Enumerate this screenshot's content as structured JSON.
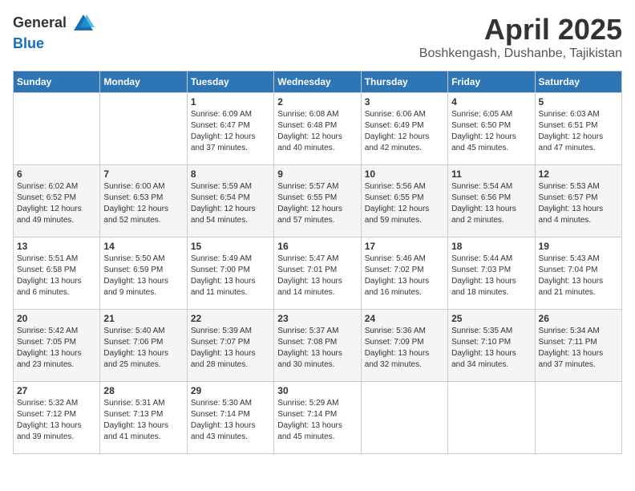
{
  "header": {
    "logo_general": "General",
    "logo_blue": "Blue",
    "month_title": "April 2025",
    "location": "Boshkengash, Dushanbe, Tajikistan"
  },
  "weekdays": [
    "Sunday",
    "Monday",
    "Tuesday",
    "Wednesday",
    "Thursday",
    "Friday",
    "Saturday"
  ],
  "weeks": [
    [
      {
        "day": "",
        "info": ""
      },
      {
        "day": "",
        "info": ""
      },
      {
        "day": "1",
        "info": "Sunrise: 6:09 AM\nSunset: 6:47 PM\nDaylight: 12 hours\nand 37 minutes."
      },
      {
        "day": "2",
        "info": "Sunrise: 6:08 AM\nSunset: 6:48 PM\nDaylight: 12 hours\nand 40 minutes."
      },
      {
        "day": "3",
        "info": "Sunrise: 6:06 AM\nSunset: 6:49 PM\nDaylight: 12 hours\nand 42 minutes."
      },
      {
        "day": "4",
        "info": "Sunrise: 6:05 AM\nSunset: 6:50 PM\nDaylight: 12 hours\nand 45 minutes."
      },
      {
        "day": "5",
        "info": "Sunrise: 6:03 AM\nSunset: 6:51 PM\nDaylight: 12 hours\nand 47 minutes."
      }
    ],
    [
      {
        "day": "6",
        "info": "Sunrise: 6:02 AM\nSunset: 6:52 PM\nDaylight: 12 hours\nand 49 minutes."
      },
      {
        "day": "7",
        "info": "Sunrise: 6:00 AM\nSunset: 6:53 PM\nDaylight: 12 hours\nand 52 minutes."
      },
      {
        "day": "8",
        "info": "Sunrise: 5:59 AM\nSunset: 6:54 PM\nDaylight: 12 hours\nand 54 minutes."
      },
      {
        "day": "9",
        "info": "Sunrise: 5:57 AM\nSunset: 6:55 PM\nDaylight: 12 hours\nand 57 minutes."
      },
      {
        "day": "10",
        "info": "Sunrise: 5:56 AM\nSunset: 6:55 PM\nDaylight: 12 hours\nand 59 minutes."
      },
      {
        "day": "11",
        "info": "Sunrise: 5:54 AM\nSunset: 6:56 PM\nDaylight: 13 hours\nand 2 minutes."
      },
      {
        "day": "12",
        "info": "Sunrise: 5:53 AM\nSunset: 6:57 PM\nDaylight: 13 hours\nand 4 minutes."
      }
    ],
    [
      {
        "day": "13",
        "info": "Sunrise: 5:51 AM\nSunset: 6:58 PM\nDaylight: 13 hours\nand 6 minutes."
      },
      {
        "day": "14",
        "info": "Sunrise: 5:50 AM\nSunset: 6:59 PM\nDaylight: 13 hours\nand 9 minutes."
      },
      {
        "day": "15",
        "info": "Sunrise: 5:49 AM\nSunset: 7:00 PM\nDaylight: 13 hours\nand 11 minutes."
      },
      {
        "day": "16",
        "info": "Sunrise: 5:47 AM\nSunset: 7:01 PM\nDaylight: 13 hours\nand 14 minutes."
      },
      {
        "day": "17",
        "info": "Sunrise: 5:46 AM\nSunset: 7:02 PM\nDaylight: 13 hours\nand 16 minutes."
      },
      {
        "day": "18",
        "info": "Sunrise: 5:44 AM\nSunset: 7:03 PM\nDaylight: 13 hours\nand 18 minutes."
      },
      {
        "day": "19",
        "info": "Sunrise: 5:43 AM\nSunset: 7:04 PM\nDaylight: 13 hours\nand 21 minutes."
      }
    ],
    [
      {
        "day": "20",
        "info": "Sunrise: 5:42 AM\nSunset: 7:05 PM\nDaylight: 13 hours\nand 23 minutes."
      },
      {
        "day": "21",
        "info": "Sunrise: 5:40 AM\nSunset: 7:06 PM\nDaylight: 13 hours\nand 25 minutes."
      },
      {
        "day": "22",
        "info": "Sunrise: 5:39 AM\nSunset: 7:07 PM\nDaylight: 13 hours\nand 28 minutes."
      },
      {
        "day": "23",
        "info": "Sunrise: 5:37 AM\nSunset: 7:08 PM\nDaylight: 13 hours\nand 30 minutes."
      },
      {
        "day": "24",
        "info": "Sunrise: 5:36 AM\nSunset: 7:09 PM\nDaylight: 13 hours\nand 32 minutes."
      },
      {
        "day": "25",
        "info": "Sunrise: 5:35 AM\nSunset: 7:10 PM\nDaylight: 13 hours\nand 34 minutes."
      },
      {
        "day": "26",
        "info": "Sunrise: 5:34 AM\nSunset: 7:11 PM\nDaylight: 13 hours\nand 37 minutes."
      }
    ],
    [
      {
        "day": "27",
        "info": "Sunrise: 5:32 AM\nSunset: 7:12 PM\nDaylight: 13 hours\nand 39 minutes."
      },
      {
        "day": "28",
        "info": "Sunrise: 5:31 AM\nSunset: 7:13 PM\nDaylight: 13 hours\nand 41 minutes."
      },
      {
        "day": "29",
        "info": "Sunrise: 5:30 AM\nSunset: 7:14 PM\nDaylight: 13 hours\nand 43 minutes."
      },
      {
        "day": "30",
        "info": "Sunrise: 5:29 AM\nSunset: 7:14 PM\nDaylight: 13 hours\nand 45 minutes."
      },
      {
        "day": "",
        "info": ""
      },
      {
        "day": "",
        "info": ""
      },
      {
        "day": "",
        "info": ""
      }
    ]
  ]
}
